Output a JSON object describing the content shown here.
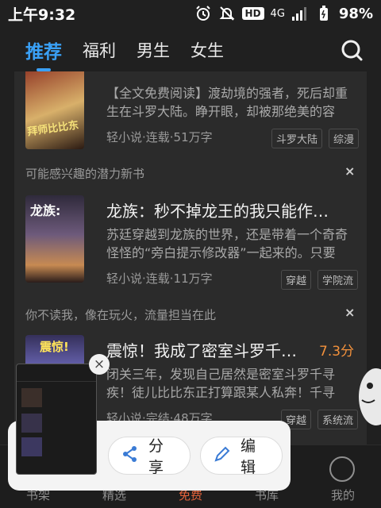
{
  "status": {
    "time": "上午9:32",
    "hd": "HD",
    "network": "4G",
    "battery": "98%"
  },
  "tabs": [
    {
      "label": "推荐",
      "active": true
    },
    {
      "label": "福利",
      "active": false
    },
    {
      "label": "男生",
      "active": false
    },
    {
      "label": "女生",
      "active": false
    }
  ],
  "books": [
    {
      "desc": "【全文免费阅读】渡劫境的强者，死后却重生在斗罗大陆。睁开眼，却被那绝美的容颜…",
      "meta": "轻小说·连载·51万字",
      "tags": [
        "斗罗大陆",
        "综漫"
      ],
      "cover_text": "拜师比比东"
    },
    {
      "section": "可能感兴趣的潜力新书",
      "title": "龙族：秒不掉龙王的我只能作…",
      "desc": "苏廷穿越到龙族的世界，还是带着一个奇奇怪怪的“旁白提示修改器”一起来的。只要消…",
      "meta": "轻小说·连载·11万字",
      "tags": [
        "穿越",
        "学院流"
      ],
      "cover_text": "龙族:"
    },
    {
      "section": "你不读我，像在玩火，流量担当在此",
      "title": "震惊！我成了密室斗罗千…",
      "rating": "7.3分",
      "desc": "闭关三年，发现自己居然是密室斗罗千寻疾！徒儿比比东正打算跟某人私奔！千寻疾…",
      "meta": "轻小说·完结·48万字",
      "tags": [
        "穿越",
        "系统流"
      ],
      "cover_text": "震惊!"
    }
  ],
  "close_symbol": "×",
  "bottom_nav": [
    {
      "label": "书架"
    },
    {
      "label": "精选"
    },
    {
      "label": "免费",
      "active": true
    },
    {
      "label": "书库"
    },
    {
      "label": "我的"
    }
  ],
  "share_panel": {
    "share": "分享",
    "edit": "编辑",
    "close": "×"
  },
  "colors": {
    "accent": "#3aa0f5",
    "orange": "#f2913c",
    "active_nav": "#e4623a"
  }
}
